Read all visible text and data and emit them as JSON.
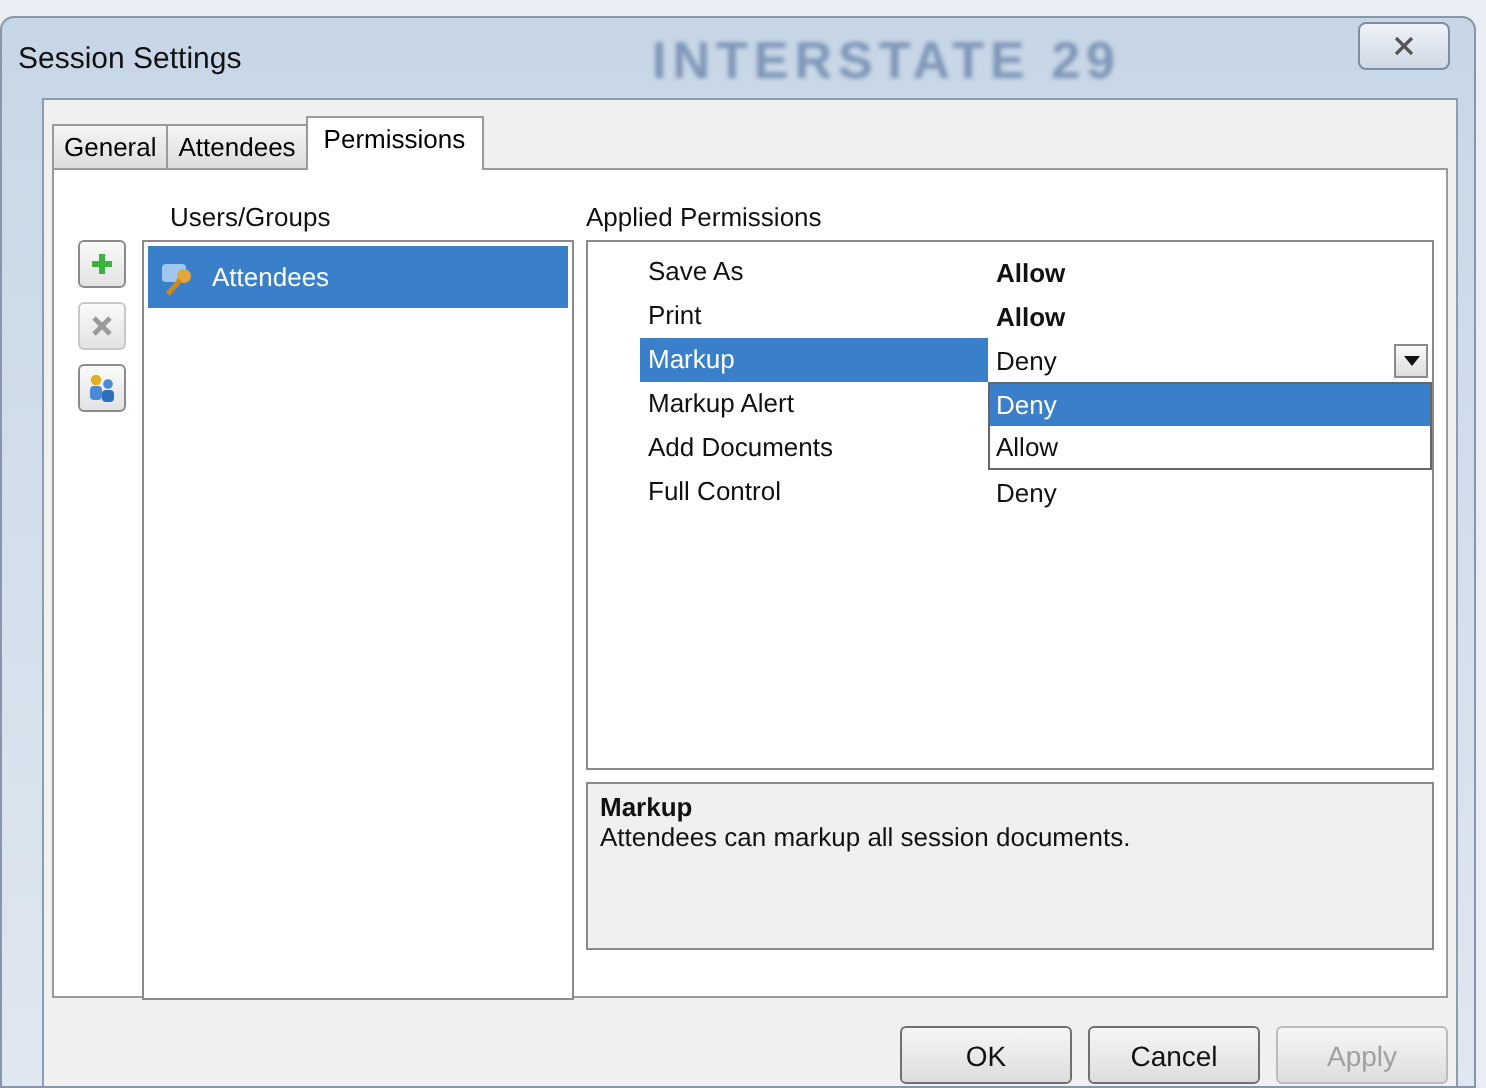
{
  "window": {
    "title": "Session Settings",
    "backdrop_text": "INTERSTATE 29"
  },
  "tabs": [
    {
      "label": "General",
      "selected": false
    },
    {
      "label": "Attendees",
      "selected": false
    },
    {
      "label": "Permissions",
      "selected": true
    }
  ],
  "users_groups": {
    "label": "Users/Groups",
    "tools": [
      {
        "kind": "add",
        "disabled": false
      },
      {
        "kind": "remove",
        "disabled": true
      },
      {
        "kind": "users",
        "disabled": false
      }
    ],
    "items": [
      {
        "label": "Attendees",
        "selected": true
      }
    ]
  },
  "permissions": {
    "label": "Applied Permissions",
    "rows": [
      {
        "name": "Save As",
        "value": "Allow",
        "bold": true,
        "selected": false
      },
      {
        "name": "Print",
        "value": "Allow",
        "bold": true,
        "selected": false
      },
      {
        "name": "Markup",
        "value": "Deny",
        "selected": true,
        "options": [
          {
            "label": "Deny",
            "selected": true
          },
          {
            "label": "Allow",
            "selected": false
          }
        ]
      },
      {
        "name": "Markup Alert",
        "selected": false
      },
      {
        "name": "Add Documents",
        "selected": false
      },
      {
        "name": "Full Control",
        "value": "Deny",
        "bold": false,
        "selected": false
      }
    ]
  },
  "description": {
    "title": "Markup",
    "text": "Attendees can markup all session documents."
  },
  "buttons": [
    {
      "label": "OK",
      "disabled": false
    },
    {
      "label": "Cancel",
      "disabled": false
    },
    {
      "label": "Apply",
      "disabled": true
    }
  ]
}
